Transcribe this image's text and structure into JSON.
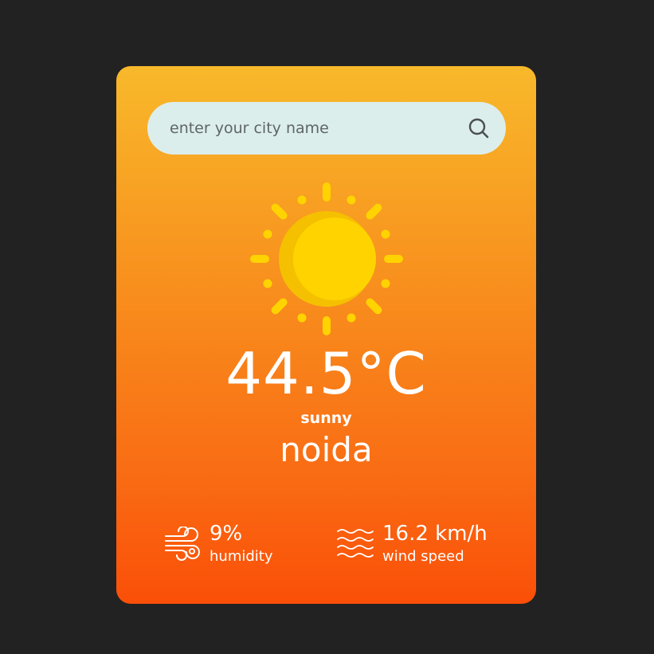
{
  "search": {
    "placeholder": "enter your city name",
    "value": ""
  },
  "weather": {
    "icon": "sun-icon",
    "temperature": "44.5°C",
    "condition": "sunny",
    "city": "noida"
  },
  "stats": {
    "humidity": {
      "icon": "wind-gust-icon",
      "value": "9%",
      "label": "humidity"
    },
    "wind": {
      "icon": "waves-icon",
      "value": "16.2 km/h",
      "label": "wind speed"
    }
  },
  "colors": {
    "page_background": "#222222",
    "card_gradient_top": "#f8b92b",
    "card_gradient_bottom": "#fa4f08",
    "search_background": "#dceeeb",
    "sun_color": "#ffd300",
    "sun_shadow": "#f5c000",
    "text": "#ffffff"
  }
}
